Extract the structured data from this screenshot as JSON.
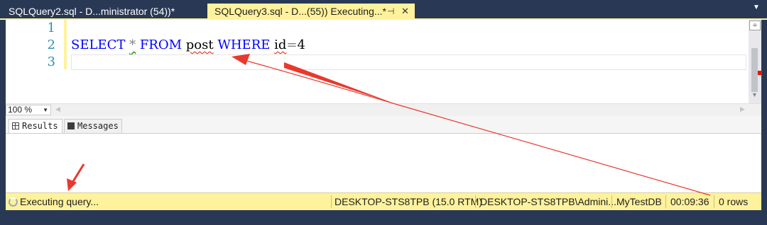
{
  "tabs": [
    {
      "title": "SQLQuery2.sql - D...ministrator (54))*"
    },
    {
      "title": "SQLQuery3.sql - D...(55)) Executing...*",
      "pin": "⊣",
      "close": "✕"
    }
  ],
  "editor": {
    "line_numbers": [
      "1",
      "2",
      "3"
    ],
    "code_tokens": {
      "select": "SELECT",
      "star": "*",
      "from": "FROM",
      "table": "post",
      "where": "WHERE",
      "col": "id",
      "eq": "=",
      "val": "4"
    }
  },
  "zoom": {
    "value": "100 %"
  },
  "result_tabs": [
    {
      "label": "Results",
      "icon": "grid-icon"
    },
    {
      "label": "Messages",
      "icon": "messages-icon"
    }
  ],
  "status": {
    "text": "Executing query...",
    "server": "DESKTOP-STS8TPB (15.0 RTM)",
    "user": "DESKTOP-STS8TPB\\Admini...",
    "database": "MyTestDB",
    "elapsed": "00:09:36",
    "rows": "0 rows"
  },
  "colors": {
    "background": "#293955",
    "active_tab": "#fff29d",
    "status_bar": "#fff29d",
    "keyword": "#0000ff",
    "annotation_arrow": "#e8392e"
  }
}
